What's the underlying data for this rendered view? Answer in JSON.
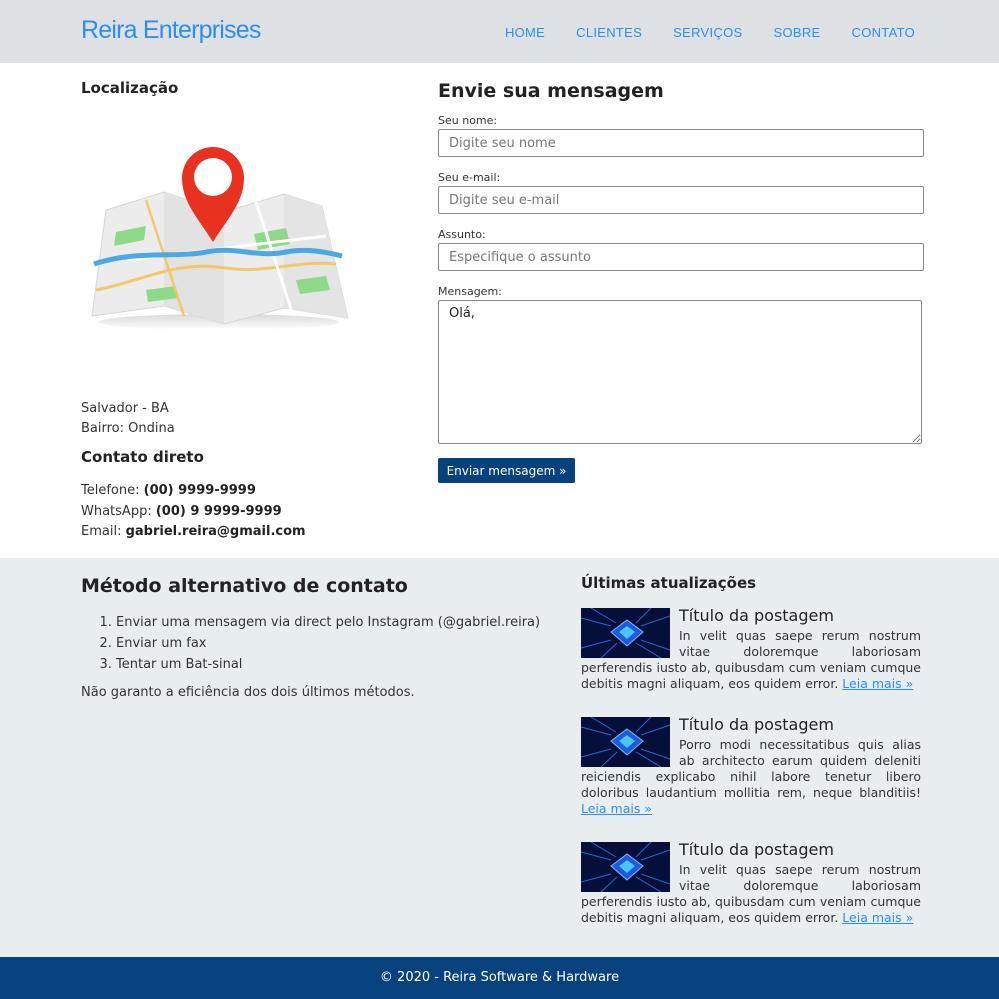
{
  "header": {
    "brand": "Reira Enterprises",
    "nav": [
      "HOME",
      "CLIENTES",
      "SERVIÇOS",
      "SOBRE",
      "CONTATO"
    ]
  },
  "location": {
    "title": "Localização",
    "map_icon": "map-pin-illustration",
    "address_line1": "Salvador - BA",
    "address_line2": "Bairro: Ondina"
  },
  "direct_contact": {
    "title": "Contato direto",
    "phone_label": "Telefone: ",
    "phone": "(00) 9999-9999",
    "whatsapp_label": "WhatsApp: ",
    "whatsapp": "(00) 9 9999-9999",
    "email_label": "Email: ",
    "email": "gabriel.reira@gmail.com"
  },
  "form": {
    "title": "Envie sua mensagem",
    "name_label": "Seu nome:",
    "name_placeholder": "Digite seu nome",
    "email_label": "Seu e-mail:",
    "email_placeholder": "Digite seu e-mail",
    "subject_label": "Assunto:",
    "subject_placeholder": "Especifique o assunto",
    "message_label": "Mensagem:",
    "message_value": "Olá,",
    "submit_label": "Enviar mensagem »",
    "accent": "#07427f"
  },
  "alternative": {
    "title": "Método alternativo de contato",
    "items": [
      "Enviar uma mensagem via direct pelo Instagram (@gabriel.reira)",
      "Enviar um fax",
      "Tentar um Bat-sinal"
    ],
    "note": "Não garanto a eficiência dos dois últimos métodos."
  },
  "updates": {
    "title": "Últimas atualizações",
    "thumb_icon": "circuit-chip-image",
    "posts": [
      {
        "title": "Título da postagem",
        "body": "In velit quas saepe rerum nostrum vitae doloremque laboriosam perferendis iusto ab, quibusdam cum veniam cumque debitis magni aliquam, eos quidem error. ",
        "more": "Leia mais »"
      },
      {
        "title": "Título da postagem",
        "body": "Porro modi necessitatibus quis alias ab architecto earum quidem deleniti reiciendis explicabo nihil labore tenetur libero doloribus laudantium mollitia rem, neque blanditiis! ",
        "more": "Leia mais »"
      },
      {
        "title": "Título da postagem",
        "body": "In velit quas saepe rerum nostrum vitae doloremque laboriosam perferendis iusto ab, quibusdam cum veniam cumque debitis magni aliquam, eos quidem error. ",
        "more": "Leia mais »"
      }
    ]
  },
  "footer": {
    "text": "© 2020 - Reira Software & Hardware"
  },
  "colors": {
    "brand": "#2d8df0",
    "header_bg": "#dde1e4",
    "band_bg": "#e8eef0",
    "footer_bg": "#07427f"
  }
}
